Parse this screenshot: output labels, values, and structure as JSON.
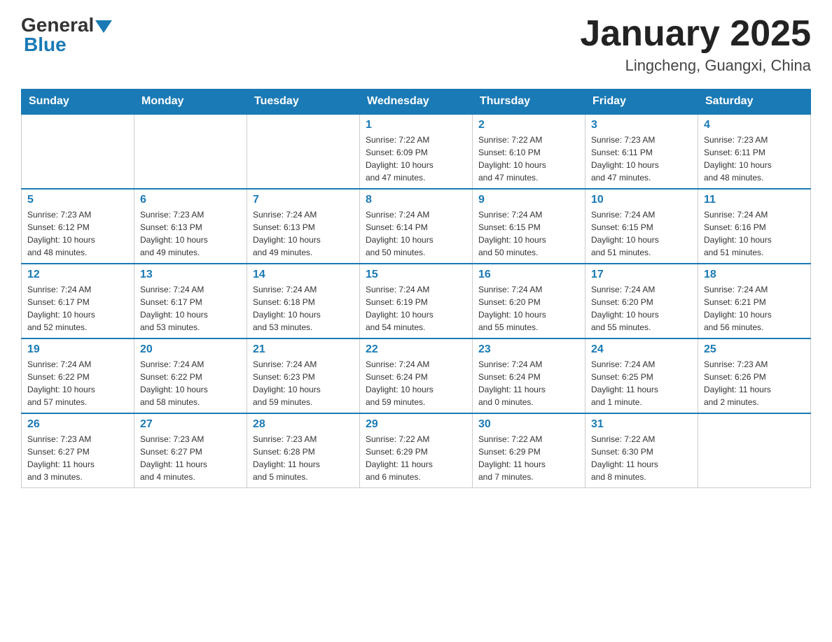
{
  "logo": {
    "general": "General",
    "blue": "Blue"
  },
  "header": {
    "month": "January 2025",
    "location": "Lingcheng, Guangxi, China"
  },
  "days_of_week": [
    "Sunday",
    "Monday",
    "Tuesday",
    "Wednesday",
    "Thursday",
    "Friday",
    "Saturday"
  ],
  "weeks": [
    [
      {
        "day": "",
        "info": ""
      },
      {
        "day": "",
        "info": ""
      },
      {
        "day": "",
        "info": ""
      },
      {
        "day": "1",
        "info": "Sunrise: 7:22 AM\nSunset: 6:09 PM\nDaylight: 10 hours\nand 47 minutes."
      },
      {
        "day": "2",
        "info": "Sunrise: 7:22 AM\nSunset: 6:10 PM\nDaylight: 10 hours\nand 47 minutes."
      },
      {
        "day": "3",
        "info": "Sunrise: 7:23 AM\nSunset: 6:11 PM\nDaylight: 10 hours\nand 47 minutes."
      },
      {
        "day": "4",
        "info": "Sunrise: 7:23 AM\nSunset: 6:11 PM\nDaylight: 10 hours\nand 48 minutes."
      }
    ],
    [
      {
        "day": "5",
        "info": "Sunrise: 7:23 AM\nSunset: 6:12 PM\nDaylight: 10 hours\nand 48 minutes."
      },
      {
        "day": "6",
        "info": "Sunrise: 7:23 AM\nSunset: 6:13 PM\nDaylight: 10 hours\nand 49 minutes."
      },
      {
        "day": "7",
        "info": "Sunrise: 7:24 AM\nSunset: 6:13 PM\nDaylight: 10 hours\nand 49 minutes."
      },
      {
        "day": "8",
        "info": "Sunrise: 7:24 AM\nSunset: 6:14 PM\nDaylight: 10 hours\nand 50 minutes."
      },
      {
        "day": "9",
        "info": "Sunrise: 7:24 AM\nSunset: 6:15 PM\nDaylight: 10 hours\nand 50 minutes."
      },
      {
        "day": "10",
        "info": "Sunrise: 7:24 AM\nSunset: 6:15 PM\nDaylight: 10 hours\nand 51 minutes."
      },
      {
        "day": "11",
        "info": "Sunrise: 7:24 AM\nSunset: 6:16 PM\nDaylight: 10 hours\nand 51 minutes."
      }
    ],
    [
      {
        "day": "12",
        "info": "Sunrise: 7:24 AM\nSunset: 6:17 PM\nDaylight: 10 hours\nand 52 minutes."
      },
      {
        "day": "13",
        "info": "Sunrise: 7:24 AM\nSunset: 6:17 PM\nDaylight: 10 hours\nand 53 minutes."
      },
      {
        "day": "14",
        "info": "Sunrise: 7:24 AM\nSunset: 6:18 PM\nDaylight: 10 hours\nand 53 minutes."
      },
      {
        "day": "15",
        "info": "Sunrise: 7:24 AM\nSunset: 6:19 PM\nDaylight: 10 hours\nand 54 minutes."
      },
      {
        "day": "16",
        "info": "Sunrise: 7:24 AM\nSunset: 6:20 PM\nDaylight: 10 hours\nand 55 minutes."
      },
      {
        "day": "17",
        "info": "Sunrise: 7:24 AM\nSunset: 6:20 PM\nDaylight: 10 hours\nand 55 minutes."
      },
      {
        "day": "18",
        "info": "Sunrise: 7:24 AM\nSunset: 6:21 PM\nDaylight: 10 hours\nand 56 minutes."
      }
    ],
    [
      {
        "day": "19",
        "info": "Sunrise: 7:24 AM\nSunset: 6:22 PM\nDaylight: 10 hours\nand 57 minutes."
      },
      {
        "day": "20",
        "info": "Sunrise: 7:24 AM\nSunset: 6:22 PM\nDaylight: 10 hours\nand 58 minutes."
      },
      {
        "day": "21",
        "info": "Sunrise: 7:24 AM\nSunset: 6:23 PM\nDaylight: 10 hours\nand 59 minutes."
      },
      {
        "day": "22",
        "info": "Sunrise: 7:24 AM\nSunset: 6:24 PM\nDaylight: 10 hours\nand 59 minutes."
      },
      {
        "day": "23",
        "info": "Sunrise: 7:24 AM\nSunset: 6:24 PM\nDaylight: 11 hours\nand 0 minutes."
      },
      {
        "day": "24",
        "info": "Sunrise: 7:24 AM\nSunset: 6:25 PM\nDaylight: 11 hours\nand 1 minute."
      },
      {
        "day": "25",
        "info": "Sunrise: 7:23 AM\nSunset: 6:26 PM\nDaylight: 11 hours\nand 2 minutes."
      }
    ],
    [
      {
        "day": "26",
        "info": "Sunrise: 7:23 AM\nSunset: 6:27 PM\nDaylight: 11 hours\nand 3 minutes."
      },
      {
        "day": "27",
        "info": "Sunrise: 7:23 AM\nSunset: 6:27 PM\nDaylight: 11 hours\nand 4 minutes."
      },
      {
        "day": "28",
        "info": "Sunrise: 7:23 AM\nSunset: 6:28 PM\nDaylight: 11 hours\nand 5 minutes."
      },
      {
        "day": "29",
        "info": "Sunrise: 7:22 AM\nSunset: 6:29 PM\nDaylight: 11 hours\nand 6 minutes."
      },
      {
        "day": "30",
        "info": "Sunrise: 7:22 AM\nSunset: 6:29 PM\nDaylight: 11 hours\nand 7 minutes."
      },
      {
        "day": "31",
        "info": "Sunrise: 7:22 AM\nSunset: 6:30 PM\nDaylight: 11 hours\nand 8 minutes."
      },
      {
        "day": "",
        "info": ""
      }
    ]
  ]
}
